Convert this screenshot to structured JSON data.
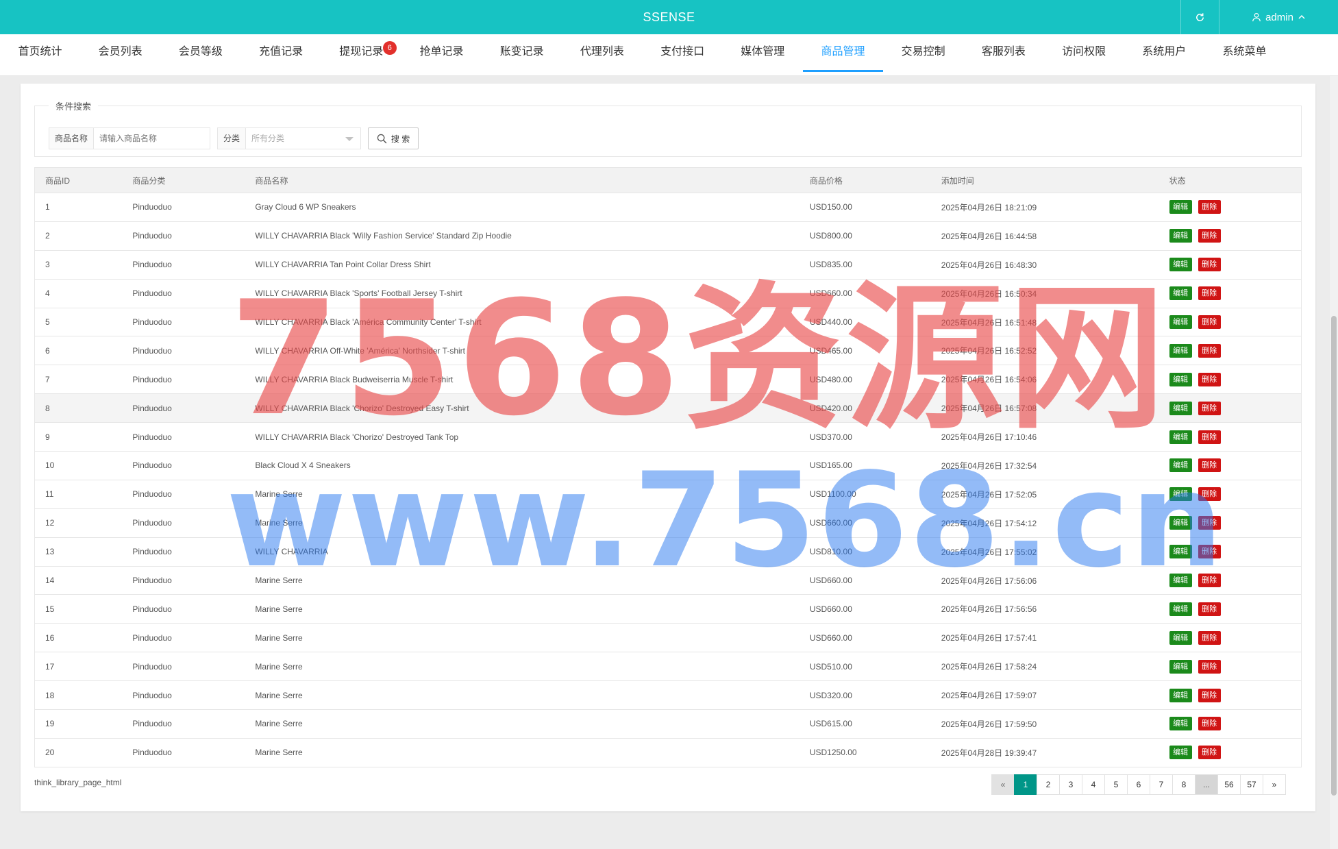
{
  "header": {
    "brand": "SSENSE",
    "user": "admin"
  },
  "nav": [
    {
      "label": "首页统计"
    },
    {
      "label": "会员列表"
    },
    {
      "label": "会员等级"
    },
    {
      "label": "充值记录"
    },
    {
      "label": "提现记录",
      "badge": "6"
    },
    {
      "label": "抢单记录"
    },
    {
      "label": "账变记录"
    },
    {
      "label": "代理列表"
    },
    {
      "label": "支付接口"
    },
    {
      "label": "媒体管理"
    },
    {
      "label": "商品管理",
      "active": true
    },
    {
      "label": "交易控制"
    },
    {
      "label": "客服列表"
    },
    {
      "label": "访问权限"
    },
    {
      "label": "系统用户"
    },
    {
      "label": "系统菜单"
    }
  ],
  "search": {
    "legend": "条件搜索",
    "name_label": "商品名称",
    "name_placeholder": "请输入商品名称",
    "category_label": "分类",
    "category_value": "所有分类",
    "button": "搜 索"
  },
  "table": {
    "headers": [
      "商品ID",
      "商品分类",
      "商品名称",
      "商品价格",
      "添加时间",
      "状态"
    ],
    "edit_label": "编辑",
    "delete_label": "删除",
    "rows": [
      {
        "id": "1",
        "category": "Pinduoduo",
        "name": "Gray Cloud 6 WP Sneakers",
        "price": "USD150.00",
        "time": "2025年04月26日 18:21:09"
      },
      {
        "id": "2",
        "category": "Pinduoduo",
        "name": "WILLY CHAVARRIA Black 'Willy Fashion Service' Standard Zip Hoodie",
        "price": "USD800.00",
        "time": "2025年04月26日 16:44:58"
      },
      {
        "id": "3",
        "category": "Pinduoduo",
        "name": "WILLY CHAVARRIA Tan Point Collar Dress Shirt",
        "price": "USD835.00",
        "time": "2025年04月26日 16:48:30"
      },
      {
        "id": "4",
        "category": "Pinduoduo",
        "name": "WILLY CHAVARRIA Black 'Sports' Football Jersey T-shirt",
        "price": "USD660.00",
        "time": "2025年04月26日 16:50:34"
      },
      {
        "id": "5",
        "category": "Pinduoduo",
        "name": "WILLY CHAVARRIA Black 'América Community Center' T-shirt",
        "price": "USD440.00",
        "time": "2025年04月26日 16:51:48"
      },
      {
        "id": "6",
        "category": "Pinduoduo",
        "name": "WILLY CHAVARRIA Off-White 'América' Northsider T-shirt",
        "price": "USD465.00",
        "time": "2025年04月26日 16:52:52"
      },
      {
        "id": "7",
        "category": "Pinduoduo",
        "name": "WILLY CHAVARRIA Black Budweiserria Muscle T-shirt",
        "price": "USD480.00",
        "time": "2025年04月26日 16:54:06"
      },
      {
        "id": "8",
        "category": "Pinduoduo",
        "name": "WILLY CHAVARRIA Black 'Chorizo' Destroyed Easy T-shirt",
        "price": "USD420.00",
        "time": "2025年04月26日 16:57:08"
      },
      {
        "id": "9",
        "category": "Pinduoduo",
        "name": "WILLY CHAVARRIA Black 'Chorizo' Destroyed Tank Top",
        "price": "USD370.00",
        "time": "2025年04月26日 17:10:46"
      },
      {
        "id": "10",
        "category": "Pinduoduo",
        "name": "Black Cloud X 4 Sneakers",
        "price": "USD165.00",
        "time": "2025年04月26日 17:32:54"
      },
      {
        "id": "11",
        "category": "Pinduoduo",
        "name": "Marine Serre",
        "price": "USD1100.00",
        "time": "2025年04月26日 17:52:05"
      },
      {
        "id": "12",
        "category": "Pinduoduo",
        "name": "Marine Serre",
        "price": "USD660.00",
        "time": "2025年04月26日 17:54:12"
      },
      {
        "id": "13",
        "category": "Pinduoduo",
        "name": "WILLY CHAVARRIA",
        "price": "USD810.00",
        "time": "2025年04月26日 17:55:02"
      },
      {
        "id": "14",
        "category": "Pinduoduo",
        "name": "Marine Serre",
        "price": "USD660.00",
        "time": "2025年04月26日 17:56:06"
      },
      {
        "id": "15",
        "category": "Pinduoduo",
        "name": "Marine Serre",
        "price": "USD660.00",
        "time": "2025年04月26日 17:56:56"
      },
      {
        "id": "16",
        "category": "Pinduoduo",
        "name": "Marine Serre",
        "price": "USD660.00",
        "time": "2025年04月26日 17:57:41"
      },
      {
        "id": "17",
        "category": "Pinduoduo",
        "name": "Marine Serre",
        "price": "USD510.00",
        "time": "2025年04月26日 17:58:24"
      },
      {
        "id": "18",
        "category": "Pinduoduo",
        "name": "Marine Serre",
        "price": "USD320.00",
        "time": "2025年04月26日 17:59:07"
      },
      {
        "id": "19",
        "category": "Pinduoduo",
        "name": "Marine Serre",
        "price": "USD615.00",
        "time": "2025年04月26日 17:59:50"
      },
      {
        "id": "20",
        "category": "Pinduoduo",
        "name": "Marine Serre",
        "price": "USD1250.00",
        "time": "2025年04月28日 19:39:47"
      }
    ]
  },
  "footer_text": "think_library_page_html",
  "pagination": [
    "«",
    "1",
    "2",
    "3",
    "4",
    "5",
    "6",
    "7",
    "8",
    "...",
    "56",
    "57",
    "»"
  ],
  "watermark": {
    "line1": "7568资源网",
    "line2": "www.7568.cn"
  },
  "colors": {
    "topbar": "#17c3c3",
    "active_tab": "#1e9fff",
    "edit": "#1b8a1b",
    "delete": "#d01414",
    "page_active": "#009688"
  }
}
